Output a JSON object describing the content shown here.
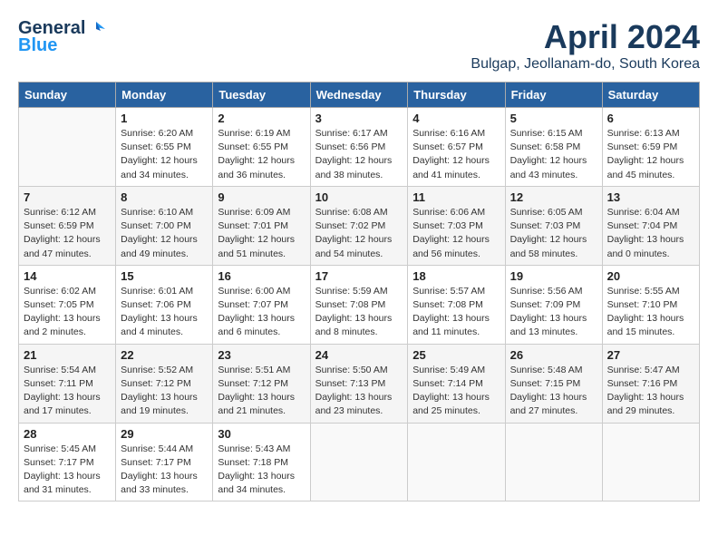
{
  "header": {
    "logo_general": "General",
    "logo_blue": "Blue",
    "title": "April 2024",
    "subtitle": "Bulgap, Jeollanam-do, South Korea"
  },
  "weekdays": [
    "Sunday",
    "Monday",
    "Tuesday",
    "Wednesday",
    "Thursday",
    "Friday",
    "Saturday"
  ],
  "weeks": [
    [
      {
        "day": "",
        "info": ""
      },
      {
        "day": "1",
        "info": "Sunrise: 6:20 AM\nSunset: 6:55 PM\nDaylight: 12 hours\nand 34 minutes."
      },
      {
        "day": "2",
        "info": "Sunrise: 6:19 AM\nSunset: 6:55 PM\nDaylight: 12 hours\nand 36 minutes."
      },
      {
        "day": "3",
        "info": "Sunrise: 6:17 AM\nSunset: 6:56 PM\nDaylight: 12 hours\nand 38 minutes."
      },
      {
        "day": "4",
        "info": "Sunrise: 6:16 AM\nSunset: 6:57 PM\nDaylight: 12 hours\nand 41 minutes."
      },
      {
        "day": "5",
        "info": "Sunrise: 6:15 AM\nSunset: 6:58 PM\nDaylight: 12 hours\nand 43 minutes."
      },
      {
        "day": "6",
        "info": "Sunrise: 6:13 AM\nSunset: 6:59 PM\nDaylight: 12 hours\nand 45 minutes."
      }
    ],
    [
      {
        "day": "7",
        "info": "Sunrise: 6:12 AM\nSunset: 6:59 PM\nDaylight: 12 hours\nand 47 minutes."
      },
      {
        "day": "8",
        "info": "Sunrise: 6:10 AM\nSunset: 7:00 PM\nDaylight: 12 hours\nand 49 minutes."
      },
      {
        "day": "9",
        "info": "Sunrise: 6:09 AM\nSunset: 7:01 PM\nDaylight: 12 hours\nand 51 minutes."
      },
      {
        "day": "10",
        "info": "Sunrise: 6:08 AM\nSunset: 7:02 PM\nDaylight: 12 hours\nand 54 minutes."
      },
      {
        "day": "11",
        "info": "Sunrise: 6:06 AM\nSunset: 7:03 PM\nDaylight: 12 hours\nand 56 minutes."
      },
      {
        "day": "12",
        "info": "Sunrise: 6:05 AM\nSunset: 7:03 PM\nDaylight: 12 hours\nand 58 minutes."
      },
      {
        "day": "13",
        "info": "Sunrise: 6:04 AM\nSunset: 7:04 PM\nDaylight: 13 hours\nand 0 minutes."
      }
    ],
    [
      {
        "day": "14",
        "info": "Sunrise: 6:02 AM\nSunset: 7:05 PM\nDaylight: 13 hours\nand 2 minutes."
      },
      {
        "day": "15",
        "info": "Sunrise: 6:01 AM\nSunset: 7:06 PM\nDaylight: 13 hours\nand 4 minutes."
      },
      {
        "day": "16",
        "info": "Sunrise: 6:00 AM\nSunset: 7:07 PM\nDaylight: 13 hours\nand 6 minutes."
      },
      {
        "day": "17",
        "info": "Sunrise: 5:59 AM\nSunset: 7:08 PM\nDaylight: 13 hours\nand 8 minutes."
      },
      {
        "day": "18",
        "info": "Sunrise: 5:57 AM\nSunset: 7:08 PM\nDaylight: 13 hours\nand 11 minutes."
      },
      {
        "day": "19",
        "info": "Sunrise: 5:56 AM\nSunset: 7:09 PM\nDaylight: 13 hours\nand 13 minutes."
      },
      {
        "day": "20",
        "info": "Sunrise: 5:55 AM\nSunset: 7:10 PM\nDaylight: 13 hours\nand 15 minutes."
      }
    ],
    [
      {
        "day": "21",
        "info": "Sunrise: 5:54 AM\nSunset: 7:11 PM\nDaylight: 13 hours\nand 17 minutes."
      },
      {
        "day": "22",
        "info": "Sunrise: 5:52 AM\nSunset: 7:12 PM\nDaylight: 13 hours\nand 19 minutes."
      },
      {
        "day": "23",
        "info": "Sunrise: 5:51 AM\nSunset: 7:12 PM\nDaylight: 13 hours\nand 21 minutes."
      },
      {
        "day": "24",
        "info": "Sunrise: 5:50 AM\nSunset: 7:13 PM\nDaylight: 13 hours\nand 23 minutes."
      },
      {
        "day": "25",
        "info": "Sunrise: 5:49 AM\nSunset: 7:14 PM\nDaylight: 13 hours\nand 25 minutes."
      },
      {
        "day": "26",
        "info": "Sunrise: 5:48 AM\nSunset: 7:15 PM\nDaylight: 13 hours\nand 27 minutes."
      },
      {
        "day": "27",
        "info": "Sunrise: 5:47 AM\nSunset: 7:16 PM\nDaylight: 13 hours\nand 29 minutes."
      }
    ],
    [
      {
        "day": "28",
        "info": "Sunrise: 5:45 AM\nSunset: 7:17 PM\nDaylight: 13 hours\nand 31 minutes."
      },
      {
        "day": "29",
        "info": "Sunrise: 5:44 AM\nSunset: 7:17 PM\nDaylight: 13 hours\nand 33 minutes."
      },
      {
        "day": "30",
        "info": "Sunrise: 5:43 AM\nSunset: 7:18 PM\nDaylight: 13 hours\nand 34 minutes."
      },
      {
        "day": "",
        "info": ""
      },
      {
        "day": "",
        "info": ""
      },
      {
        "day": "",
        "info": ""
      },
      {
        "day": "",
        "info": ""
      }
    ]
  ]
}
